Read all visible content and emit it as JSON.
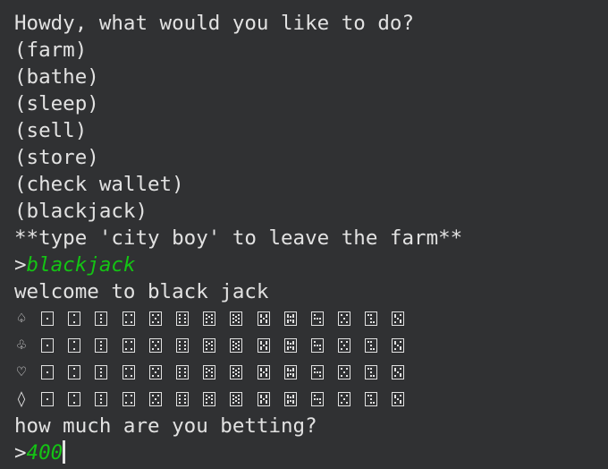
{
  "terminal": {
    "greeting": "Howdy, what would you like to do?",
    "options": [
      "(farm)",
      "(bathe)",
      "(sleep)",
      "(sell)",
      "(store)",
      "(check wallet)",
      "(blackjack)"
    ],
    "leave_hint": "**type 'city boy' to leave the farm**",
    "prompt_symbol": ">",
    "command_entered": "blackjack",
    "welcome_message": "welcome to black jack",
    "deck": {
      "suits": [
        "♤",
        "♧",
        "♡",
        "◊"
      ],
      "card_names": [
        "A",
        "2",
        "3",
        "4",
        "5",
        "6",
        "7",
        "8",
        "9",
        "10",
        "J",
        "Q",
        "K",
        "card-back"
      ],
      "card_icon": "playing-card-icon"
    },
    "bet_question": "how much are you betting?",
    "bet_input": "400",
    "colors": {
      "background": "#303133",
      "text": "#e2e2e2",
      "input": "#14c414"
    }
  }
}
